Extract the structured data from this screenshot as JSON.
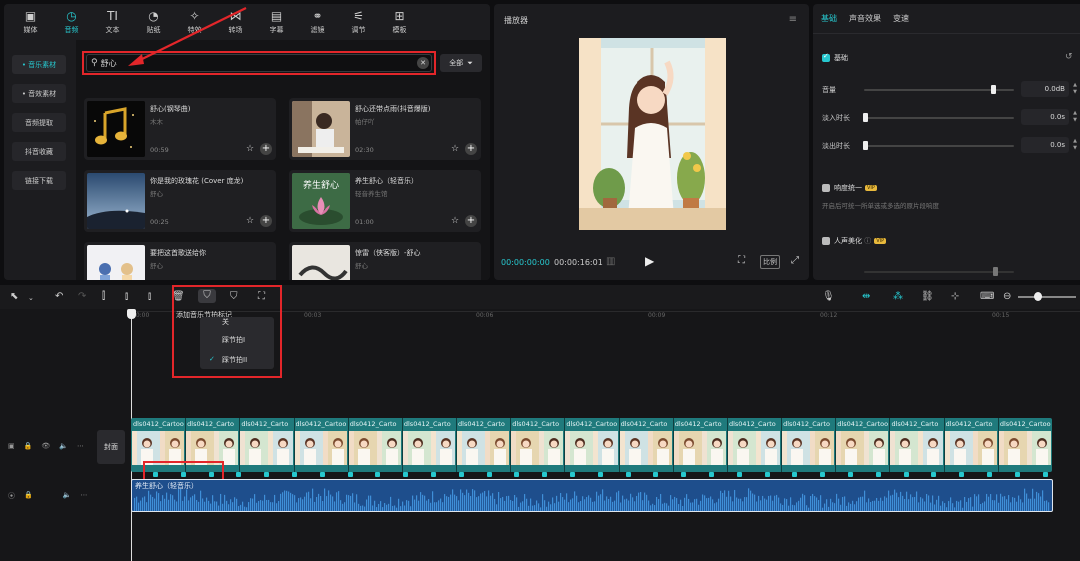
{
  "toolbar": [
    {
      "label": "媒体",
      "icon": "▣"
    },
    {
      "label": "音频",
      "icon": "◷"
    },
    {
      "label": "文本",
      "icon": "TI"
    },
    {
      "label": "贴纸",
      "icon": "◔"
    },
    {
      "label": "特效",
      "icon": "✧"
    },
    {
      "label": "转场",
      "icon": "⋈"
    },
    {
      "label": "字幕",
      "icon": "▤"
    },
    {
      "label": "滤镜",
      "icon": "⚭"
    },
    {
      "label": "调节",
      "icon": "⚟"
    },
    {
      "label": "模板",
      "icon": "⊞"
    }
  ],
  "sidebar": [
    {
      "label": "• 音乐素材",
      "active": true
    },
    {
      "label": "• 音效素材"
    },
    {
      "label": "音频提取"
    },
    {
      "label": "抖音收藏"
    },
    {
      "label": "链接下载"
    }
  ],
  "search": {
    "value": "舒心",
    "all_label": "全部"
  },
  "cards": [
    {
      "title": "舒心(钢琴曲)",
      "artist": "木木",
      "duration": "00:59"
    },
    {
      "title": "舒心还带点雨(抖音爆版)",
      "artist": "帕仔吖",
      "duration": "02:30"
    },
    {
      "title": "你是我的玫瑰花 (Cover 庞龙)",
      "artist": "舒心",
      "duration": "00:25"
    },
    {
      "title": "养生舒心（轻音乐）",
      "artist": "轻音养生馆",
      "duration": "01:00"
    },
    {
      "title": "要把这首歌送给你",
      "artist": "舒心"
    },
    {
      "title": "惊雷（侠客版）-舒心",
      "artist": "舒心"
    }
  ],
  "thumb_texts": {
    "card3": "养生舒心"
  },
  "player": {
    "title": "播放器",
    "time_current": "00:00:00:00",
    "time_total": "00:00:16:01",
    "ratio_label": "比例"
  },
  "props": {
    "tabs": [
      "基础",
      "声音效果",
      "变速"
    ],
    "section_basic": "基础",
    "volume_label": "音量",
    "volume_value": "0.0dB",
    "volume_level": 0.86,
    "fadein_label": "淡入时长",
    "fadein_value": "0.0s",
    "fadeout_label": "淡出时长",
    "fadeout_value": "0.0s",
    "loudness_label": "响度统一",
    "loudness_desc": "开启后可统一所单选或多选的原片段响度",
    "voice_label": "人声美化",
    "vip": "VIP"
  },
  "timeline": {
    "ticks": [
      "00:00",
      "00:03",
      "00:06",
      "00:09",
      "00:12",
      "00:15"
    ],
    "tooltip": "添加音乐节拍标记",
    "menu_items": [
      "踩节拍I",
      "踩节拍II"
    ],
    "menu_peek": "关",
    "cover_label": "封面",
    "video_clip_names": [
      "dls0412_Cartoon_illust",
      "dls0412_Carto",
      "dls0412_Carto",
      "dls0412_Cartoo",
      "dls0412_Carto",
      "dls0412_Carto",
      "dls0412_Carto",
      "dls0412_Carto",
      "dls0412_Cartoo",
      "dls0412_Carto",
      "dls0412_Carto",
      "dls0412_Carto",
      "dls0412_Carto",
      "dls0412_Cartoo",
      "dls0412_Carto",
      "dls0412_Carto",
      "dls0412_Cartoo"
    ],
    "audio_clip_name": "养生舒心（轻音乐）"
  },
  "colors": {
    "accent": "#27c8cf",
    "highlight": "#e3262a",
    "video_track": "#1f7a7c",
    "audio_track": "#1e4e8c"
  }
}
